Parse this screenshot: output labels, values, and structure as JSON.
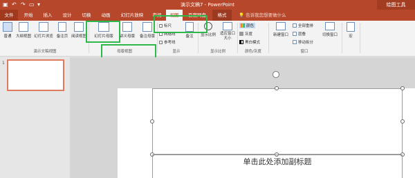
{
  "titlebar": {
    "title": "演示文稿7 - PowerPoint",
    "context_label": "绘图工具",
    "undo": "↶",
    "redo": "↷"
  },
  "tabs": [
    {
      "label": "文件"
    },
    {
      "label": "开始"
    },
    {
      "label": "插入"
    },
    {
      "label": "设计"
    },
    {
      "label": "切换"
    },
    {
      "label": "动画"
    },
    {
      "label": "幻灯片放映"
    },
    {
      "label": "审阅"
    },
    {
      "label": "视图"
    },
    {
      "label": "百度网盘"
    },
    {
      "label": "格式"
    }
  ],
  "tell_me": "告诉我您想要做什么",
  "ribbon": {
    "presentation_views": {
      "normal": "普通",
      "outline": "大纲视图",
      "slide_sorter": "幻灯片浏览",
      "notes_page": "备注页",
      "reading_view": "阅读视图",
      "group_label": "演示文稿视图"
    },
    "master_views": {
      "slide_master": "幻灯片母版",
      "handout_master": "讲义母版",
      "notes_master": "备注母版",
      "group_label": "母版视图"
    },
    "show": {
      "ruler": "标尺",
      "gridlines": "网格线",
      "guides": "参考线",
      "notes": "备注",
      "group_label": "显示"
    },
    "zoom": {
      "zoom": "显示比例",
      "fit_window": "适应窗口大小",
      "group_label": "显示比例"
    },
    "color": {
      "color": "颜色",
      "grayscale": "灰度",
      "black_white": "黑白模式",
      "group_label": "颜色/灰度"
    },
    "window": {
      "new_window": "新建窗口",
      "arrange_all": "全部重排",
      "cascade": "层叠",
      "move_split": "移动拆分",
      "switch_windows": "切换窗口",
      "group_label": "窗口"
    },
    "macros": {
      "macros": "宏"
    }
  },
  "thumbnail": {
    "number": "1"
  },
  "slide": {
    "subtitle_placeholder": "单击此处添加副标题"
  }
}
